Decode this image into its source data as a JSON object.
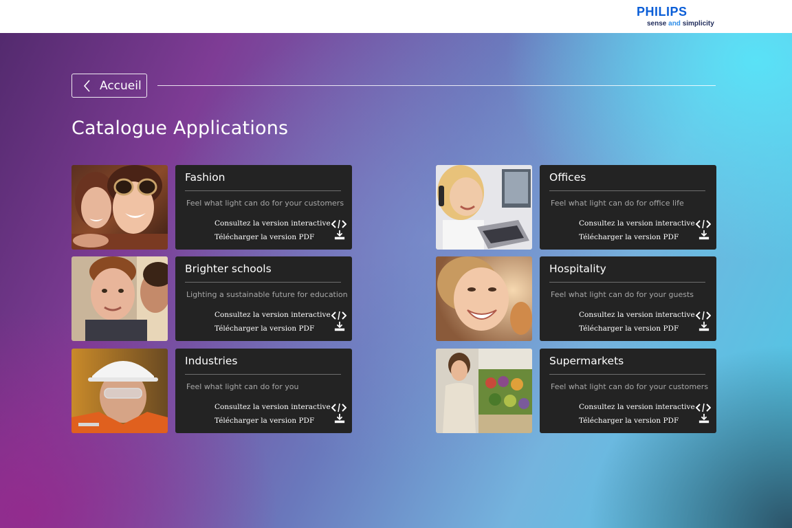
{
  "header": {
    "brand": "PHILIPS",
    "tagline_pre": "sense ",
    "tagline_and": "and",
    "tagline_post": " simplicity",
    "brand_color": "#0b5ed7"
  },
  "nav": {
    "back_label": "Accueil",
    "back_icon": "chevron-left-icon"
  },
  "page": {
    "title": "Catalogue Applications"
  },
  "cards": [
    {
      "title": "Fashion",
      "subtitle": "Feel what light can do for your customers",
      "interactive_label": "Consultez la version interactive",
      "pdf_label": "Télécharger la version PDF"
    },
    {
      "title": "Brighter schools",
      "subtitle": "Lighting a sustainable future for education",
      "interactive_label": "Consultez la version interactive",
      "pdf_label": "Télécharger la version PDF"
    },
    {
      "title": "Industries",
      "subtitle": "Feel what light can do for you",
      "interactive_label": "Consultez la version interactive",
      "pdf_label": "Télécharger la version PDF"
    },
    {
      "title": "Offices",
      "subtitle": "Feel what light can do for office life",
      "interactive_label": "Consultez la version interactive",
      "pdf_label": "Télécharger la version PDF"
    },
    {
      "title": "Hospitality",
      "subtitle": "Feel what light can do for your guests",
      "interactive_label": "Consultez la version interactive",
      "pdf_label": "Télécharger la version PDF"
    },
    {
      "title": "Supermarkets",
      "subtitle": "Feel what light can do for your customers",
      "interactive_label": "Consultez la version interactive",
      "pdf_label": "Télécharger la version PDF"
    }
  ],
  "icons": {
    "interactive": "code-arrows-icon",
    "pdf": "download-icon"
  }
}
